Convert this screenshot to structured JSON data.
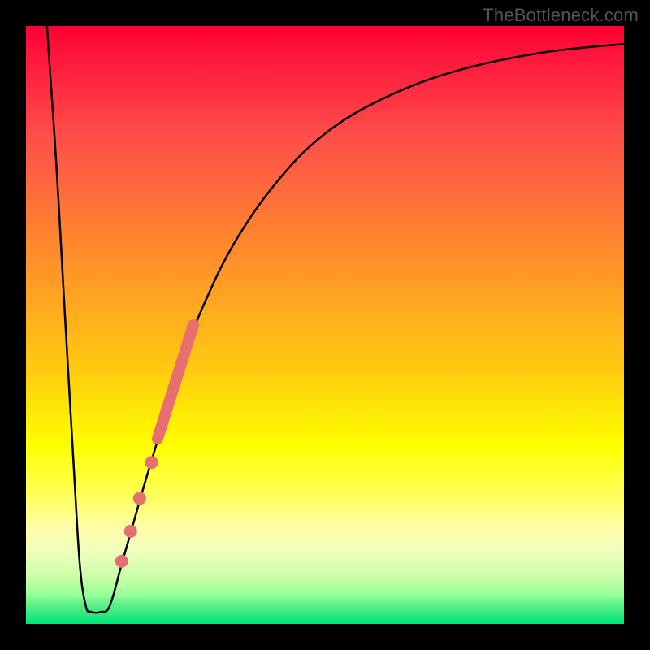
{
  "watermark": {
    "text": "TheBottleneck.com"
  },
  "chart_data": {
    "type": "line",
    "title": "",
    "xlabel": "",
    "ylabel": "",
    "xlim": [
      0,
      100
    ],
    "ylim": [
      0,
      100
    ],
    "background_gradient": {
      "direction": "top-to-bottom",
      "stops": [
        {
          "pos": 0.0,
          "color": "#ff0033"
        },
        {
          "pos": 0.5,
          "color": "#ffb300"
        },
        {
          "pos": 0.75,
          "color": "#ffff00"
        },
        {
          "pos": 0.9,
          "color": "#ddffaa"
        },
        {
          "pos": 1.0,
          "color": "#00e676"
        }
      ]
    },
    "series": [
      {
        "name": "bottleneck-curve",
        "color": "#000000",
        "points": [
          {
            "x": 3.5,
            "y": 100.0
          },
          {
            "x": 5.0,
            "y": 78.0
          },
          {
            "x": 6.5,
            "y": 52.0
          },
          {
            "x": 8.0,
            "y": 26.0
          },
          {
            "x": 9.0,
            "y": 10.0
          },
          {
            "x": 10.0,
            "y": 3.0
          },
          {
            "x": 11.0,
            "y": 2.0
          },
          {
            "x": 12.5,
            "y": 2.0
          },
          {
            "x": 14.0,
            "y": 3.0
          },
          {
            "x": 16.0,
            "y": 10.0
          },
          {
            "x": 18.0,
            "y": 17.0
          },
          {
            "x": 20.0,
            "y": 24.0
          },
          {
            "x": 23.0,
            "y": 34.0
          },
          {
            "x": 26.0,
            "y": 44.0
          },
          {
            "x": 30.0,
            "y": 54.0
          },
          {
            "x": 35.0,
            "y": 64.0
          },
          {
            "x": 42.0,
            "y": 74.0
          },
          {
            "x": 50.0,
            "y": 82.0
          },
          {
            "x": 60.0,
            "y": 88.0
          },
          {
            "x": 72.0,
            "y": 92.5
          },
          {
            "x": 86.0,
            "y": 95.5
          },
          {
            "x": 100.0,
            "y": 97.0
          }
        ]
      },
      {
        "name": "highlight-segment",
        "type": "segment",
        "color": "#e76f6f",
        "width": 14,
        "from": {
          "x": 22.0,
          "y": 31.0
        },
        "to": {
          "x": 28.0,
          "y": 50.0
        }
      },
      {
        "name": "highlight-dots",
        "type": "scatter",
        "color": "#e76f6f",
        "radius": 8,
        "points": [
          {
            "x": 21.0,
            "y": 27.0
          },
          {
            "x": 19.0,
            "y": 21.0
          },
          {
            "x": 17.5,
            "y": 15.5
          },
          {
            "x": 16.0,
            "y": 10.5
          }
        ]
      }
    ]
  }
}
